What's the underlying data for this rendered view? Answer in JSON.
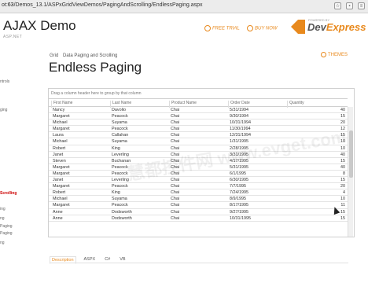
{
  "browser": {
    "url_prefix": "ot",
    "url_host": ":63",
    "url_path": "/Demos_13.1/ASPxGridViewDemos/PagingAndScrolling/EndlessPaging.aspx"
  },
  "header": {
    "title": "AJAX Demo",
    "subtitle": "ASP.NET",
    "free_trial": "FREE TRIAL",
    "buy_now": "BUY NOW",
    "logo_dev": "Dev",
    "logo_express": "Express",
    "powered": "POWERED BY"
  },
  "sidebar": {
    "items": [
      {
        "label": "ntrols",
        "active": false
      },
      {
        "label": "ging",
        "active": false
      },
      {
        "label": "Scrolling",
        "active": true
      },
      {
        "label": "ing",
        "active": false
      },
      {
        "label": "ng",
        "active": false
      },
      {
        "label": "Paging",
        "active": false
      },
      {
        "label": "Paging",
        "active": false
      },
      {
        "label": "ng",
        "active": false
      }
    ]
  },
  "breadcrumb": {
    "a": "Grid",
    "b": "Data Paging and Scrolling"
  },
  "page_title": "Endless Paging",
  "themes_label": "THEMES",
  "grid": {
    "group_panel": "Drag a column header here to group by that column",
    "columns": [
      "First Name",
      "Last Name",
      "Product Name",
      "Order Date",
      "Quantity"
    ],
    "rows": [
      [
        "Nancy",
        "Davolio",
        "Chai",
        "5/31/1994",
        "40"
      ],
      [
        "Margaret",
        "Peacock",
        "Chai",
        "9/30/1994",
        "15"
      ],
      [
        "Michael",
        "Suyama",
        "Chai",
        "10/31/1994",
        "20"
      ],
      [
        "Margaret",
        "Peacock",
        "Chai",
        "11/30/1994",
        "12"
      ],
      [
        "Laura",
        "Callahan",
        "Chai",
        "12/31/1994",
        "15"
      ],
      [
        "Michael",
        "Suyama",
        "Chai",
        "1/31/1995",
        "10"
      ],
      [
        "Robert",
        "King",
        "Chai",
        "2/28/1995",
        "10"
      ],
      [
        "Janet",
        "Leverling",
        "Chai",
        "3/31/1995",
        "40"
      ],
      [
        "Steven",
        "Buchanan",
        "Chai",
        "4/17/1995",
        "15"
      ],
      [
        "Margaret",
        "Peacock",
        "Chai",
        "5/31/1995",
        "40"
      ],
      [
        "Margaret",
        "Peacock",
        "Chai",
        "6/1/1995",
        "8"
      ],
      [
        "Janet",
        "Leverling",
        "Chai",
        "6/30/1995",
        "15"
      ],
      [
        "Margaret",
        "Peacock",
        "Chai",
        "7/7/1995",
        "20"
      ],
      [
        "Robert",
        "King",
        "Chai",
        "7/24/1995",
        "4"
      ],
      [
        "Michael",
        "Suyama",
        "Chai",
        "8/9/1995",
        "10"
      ],
      [
        "Margaret",
        "Peacock",
        "Chai",
        "8/17/1995",
        "11"
      ],
      [
        "Anne",
        "Dodsworth",
        "Chai",
        "9/27/1995",
        "15"
      ],
      [
        "Anne",
        "Dodsworth",
        "Chai",
        "10/31/1995",
        "15"
      ]
    ]
  },
  "tabs": [
    "Description",
    "ASPX",
    "C#",
    "VB"
  ],
  "watermark": "慧都控件网 www.evget.com",
  "colors": {
    "accent": "#e8891d",
    "text": "#333333"
  }
}
